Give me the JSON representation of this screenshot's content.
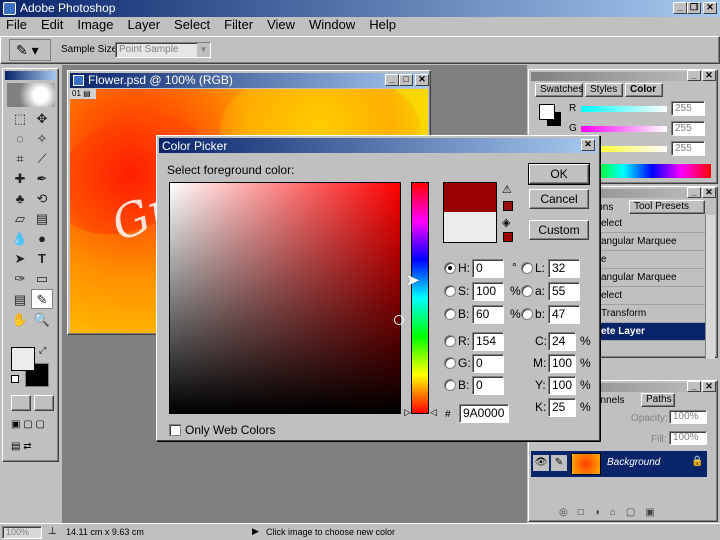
{
  "app": {
    "title": "Adobe Photoshop"
  },
  "menu": [
    "File",
    "Edit",
    "Image",
    "Layer",
    "Select",
    "Filter",
    "View",
    "Window",
    "Help"
  ],
  "options": {
    "sample_label": "Sample Size:",
    "sample_value": "Point Sample"
  },
  "document": {
    "title": "Flower.psd @ 100% (RGB)"
  },
  "dialog": {
    "title": "Color Picker",
    "prompt": "Select foreground color:",
    "ok": "OK",
    "cancel": "Cancel",
    "custom": "Custom",
    "only_web": "Only Web Colors",
    "hex_label": "#",
    "hex": "9A0000",
    "new_color": "#9a0000",
    "old_color": "#ececec",
    "hsb": {
      "h_label": "H:",
      "h": "0",
      "h_unit": "°",
      "s_label": "S:",
      "s": "100",
      "s_unit": "%",
      "b_label": "B:",
      "b": "60",
      "b_unit": "%"
    },
    "rgb": {
      "r_label": "R:",
      "r": "154",
      "g_label": "G:",
      "g": "0",
      "b_label": "B:",
      "b": "0"
    },
    "lab": {
      "l_label": "L:",
      "l": "32",
      "a_label": "a:",
      "a": "55",
      "b_label": "b:",
      "b": "47"
    },
    "cmyk": {
      "c_label": "C:",
      "c": "24",
      "m_label": "M:",
      "m": "100",
      "y_label": "Y:",
      "y": "100",
      "k_label": "K:",
      "k": "25",
      "unit": "%"
    }
  },
  "color_palette": {
    "tabs": [
      "Swatches",
      "Styles",
      "Color"
    ],
    "r_label": "R",
    "g_label": "G",
    "b_label": "B",
    "r": "255",
    "g": "255",
    "b": "255"
  },
  "history_palette": {
    "tabs": [
      "ions",
      "Tool Presets"
    ],
    "items": [
      "elect",
      "angular Marquee",
      "e",
      "angular Marquee",
      "elect",
      " Transform",
      "ete Layer"
    ]
  },
  "layers_palette": {
    "tabs": [
      "annels",
      "Paths"
    ],
    "opacity_label": "Opacity:",
    "opacity": "100%",
    "fill_label": "Fill:",
    "fill": "100%",
    "layer_name": "Background"
  },
  "status": {
    "zoom": "100%",
    "size": "14.11 cm x 9.63 cm",
    "hint": "Click image to choose new color"
  },
  "artwork_text": "Gr"
}
